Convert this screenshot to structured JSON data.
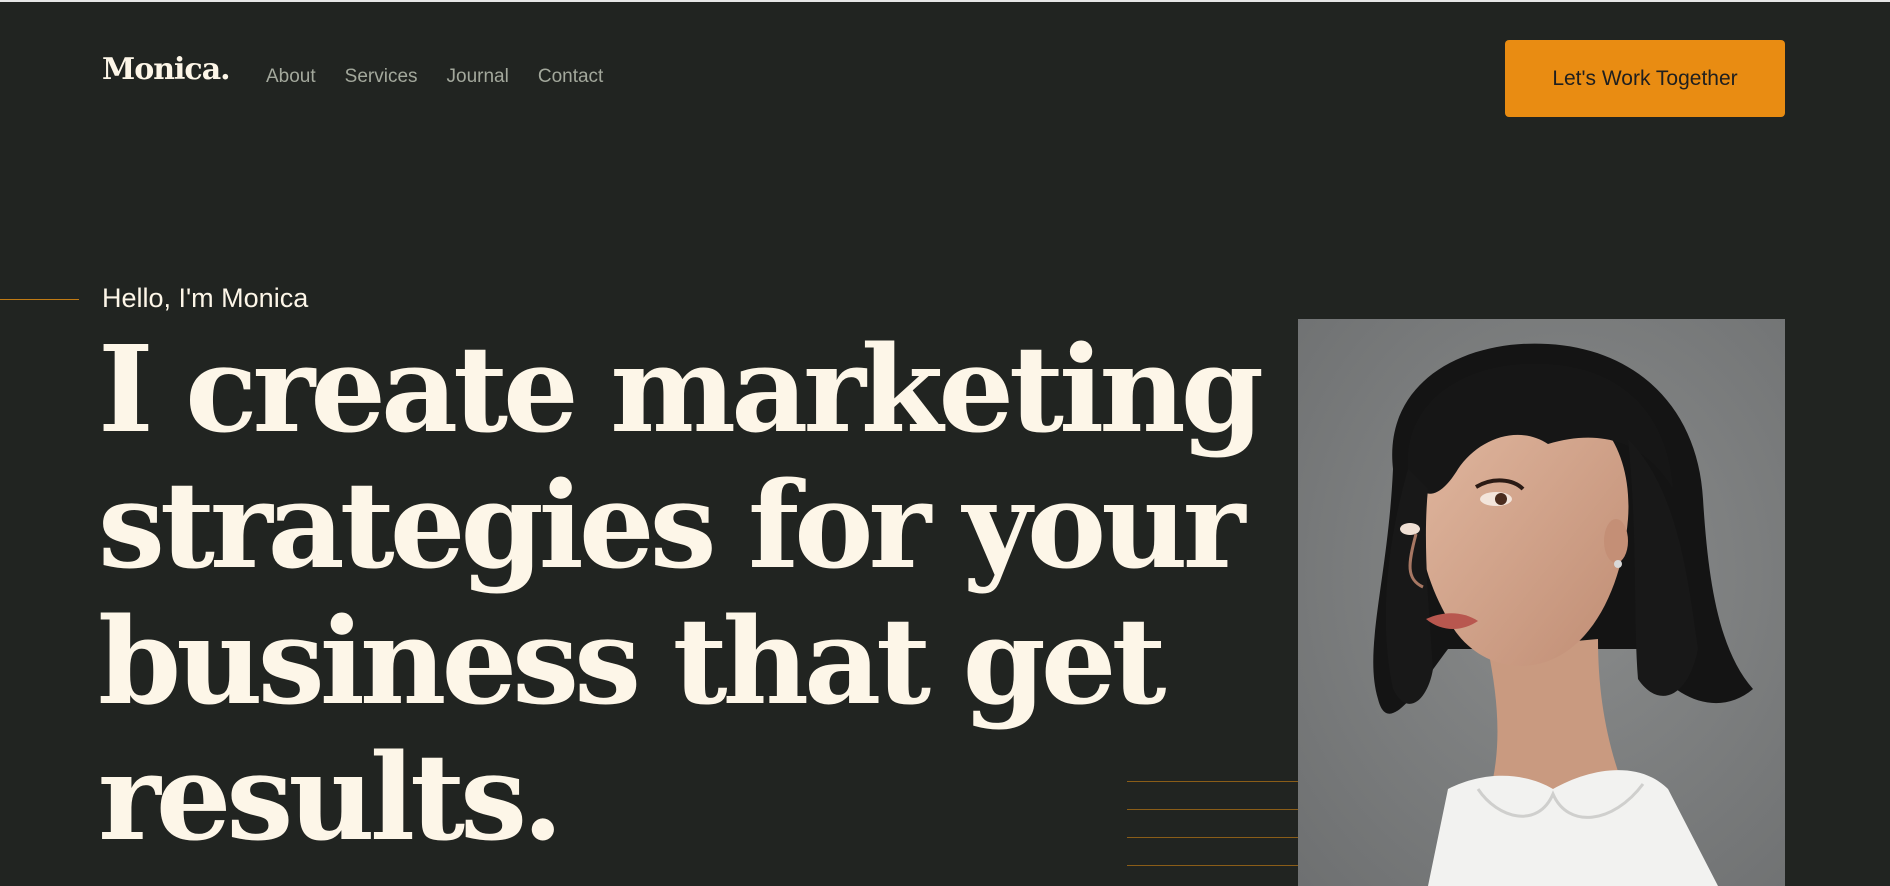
{
  "brand": {
    "logo": "Monica."
  },
  "nav": {
    "items": [
      {
        "label": "About"
      },
      {
        "label": "Services"
      },
      {
        "label": "Journal"
      },
      {
        "label": "Contact"
      }
    ]
  },
  "header": {
    "cta_label": "Let's Work Together"
  },
  "hero": {
    "greeting": "Hello, I'm Monica",
    "headline_lines": [
      "I create marketing",
      "strategies for your",
      "business that get",
      "results."
    ]
  },
  "colors": {
    "background": "#212421",
    "accent": "#e98c12",
    "headline": "#fdf6e8",
    "nav_text": "#a3a89c"
  },
  "icons": {
    "portrait": "portrait-photo"
  }
}
